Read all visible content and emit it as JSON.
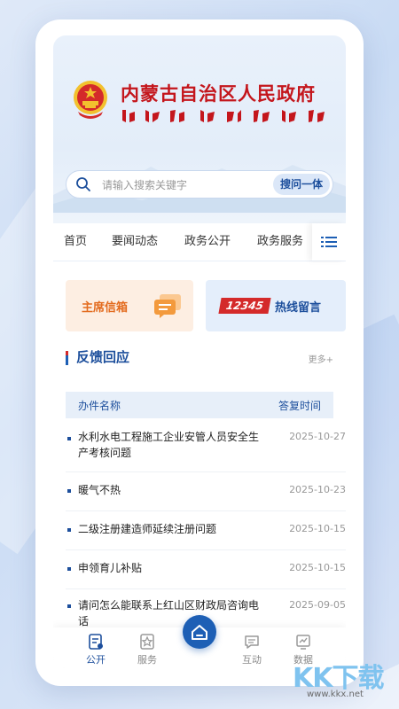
{
  "header": {
    "title": "内蒙古自治区人民政府",
    "emblem_icon": "national-emblem-icon",
    "title_color": "#c4161c"
  },
  "search": {
    "placeholder": "请输入搜索关键字",
    "button_label": "搜问一体"
  },
  "nav": {
    "tabs": [
      "首页",
      "要闻动态",
      "政务公开",
      "政务服务"
    ],
    "menu_icon": "list-menu-icon"
  },
  "quick_cards": {
    "mailbox_label": "主席信箱",
    "hotline_number": "12345",
    "hotline_label": "热线留言"
  },
  "section": {
    "title": "反馈回应",
    "more_label": "更多+",
    "col_name": "办件名称",
    "col_date": "答复时间"
  },
  "rows": [
    {
      "title": "水利水电工程施工企业安管人员安全生产考核问题",
      "date": "2025-10-27"
    },
    {
      "title": "暖气不热",
      "date": "2025-10-23"
    },
    {
      "title": "二级注册建造师延续注册问题",
      "date": "2025-10-15"
    },
    {
      "title": "申领育儿补贴",
      "date": "2025-10-15"
    },
    {
      "title": "请问怎么能联系上红山区财政局咨询电话",
      "date": "2025-09-05"
    }
  ],
  "bottom_tabs": [
    {
      "label": "公开",
      "icon": "document-icon",
      "active": true
    },
    {
      "label": "服务",
      "icon": "star-badge-icon",
      "active": false
    },
    {
      "label": "",
      "icon": "home-icon",
      "active": false
    },
    {
      "label": "互动",
      "icon": "chat-icon",
      "active": false
    },
    {
      "label": "数据",
      "icon": "chart-icon",
      "active": false
    }
  ],
  "watermark": {
    "brand": "KK下载",
    "url": "www.kkx.net"
  },
  "colors": {
    "primary": "#1d5fb5",
    "accent_red": "#d42a2a",
    "mail_orange": "#e36b1e"
  }
}
